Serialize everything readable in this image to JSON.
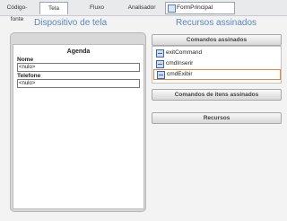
{
  "tabs": {
    "codigo": "Código-fonte",
    "tela": "Tela",
    "fluxo": "Fluxo",
    "analisador": "Analisador"
  },
  "form_selector": {
    "value": "FormPrincipal"
  },
  "device_panel": {
    "heading": "Dispositivo de tela",
    "screen_title": "Agenda",
    "fields": [
      {
        "label": "Nome",
        "value": "<nulo>"
      },
      {
        "label": "Telefone",
        "value": "<nulo>"
      }
    ]
  },
  "resources_panel": {
    "heading": "Recursos assinados",
    "commands_button": "Comandos assinados",
    "commands": [
      "exitCommand",
      "cmdInserir",
      "cmdExibir"
    ],
    "item_commands_button": "Comandos de itens assinados",
    "resources_button": "Recursos"
  }
}
